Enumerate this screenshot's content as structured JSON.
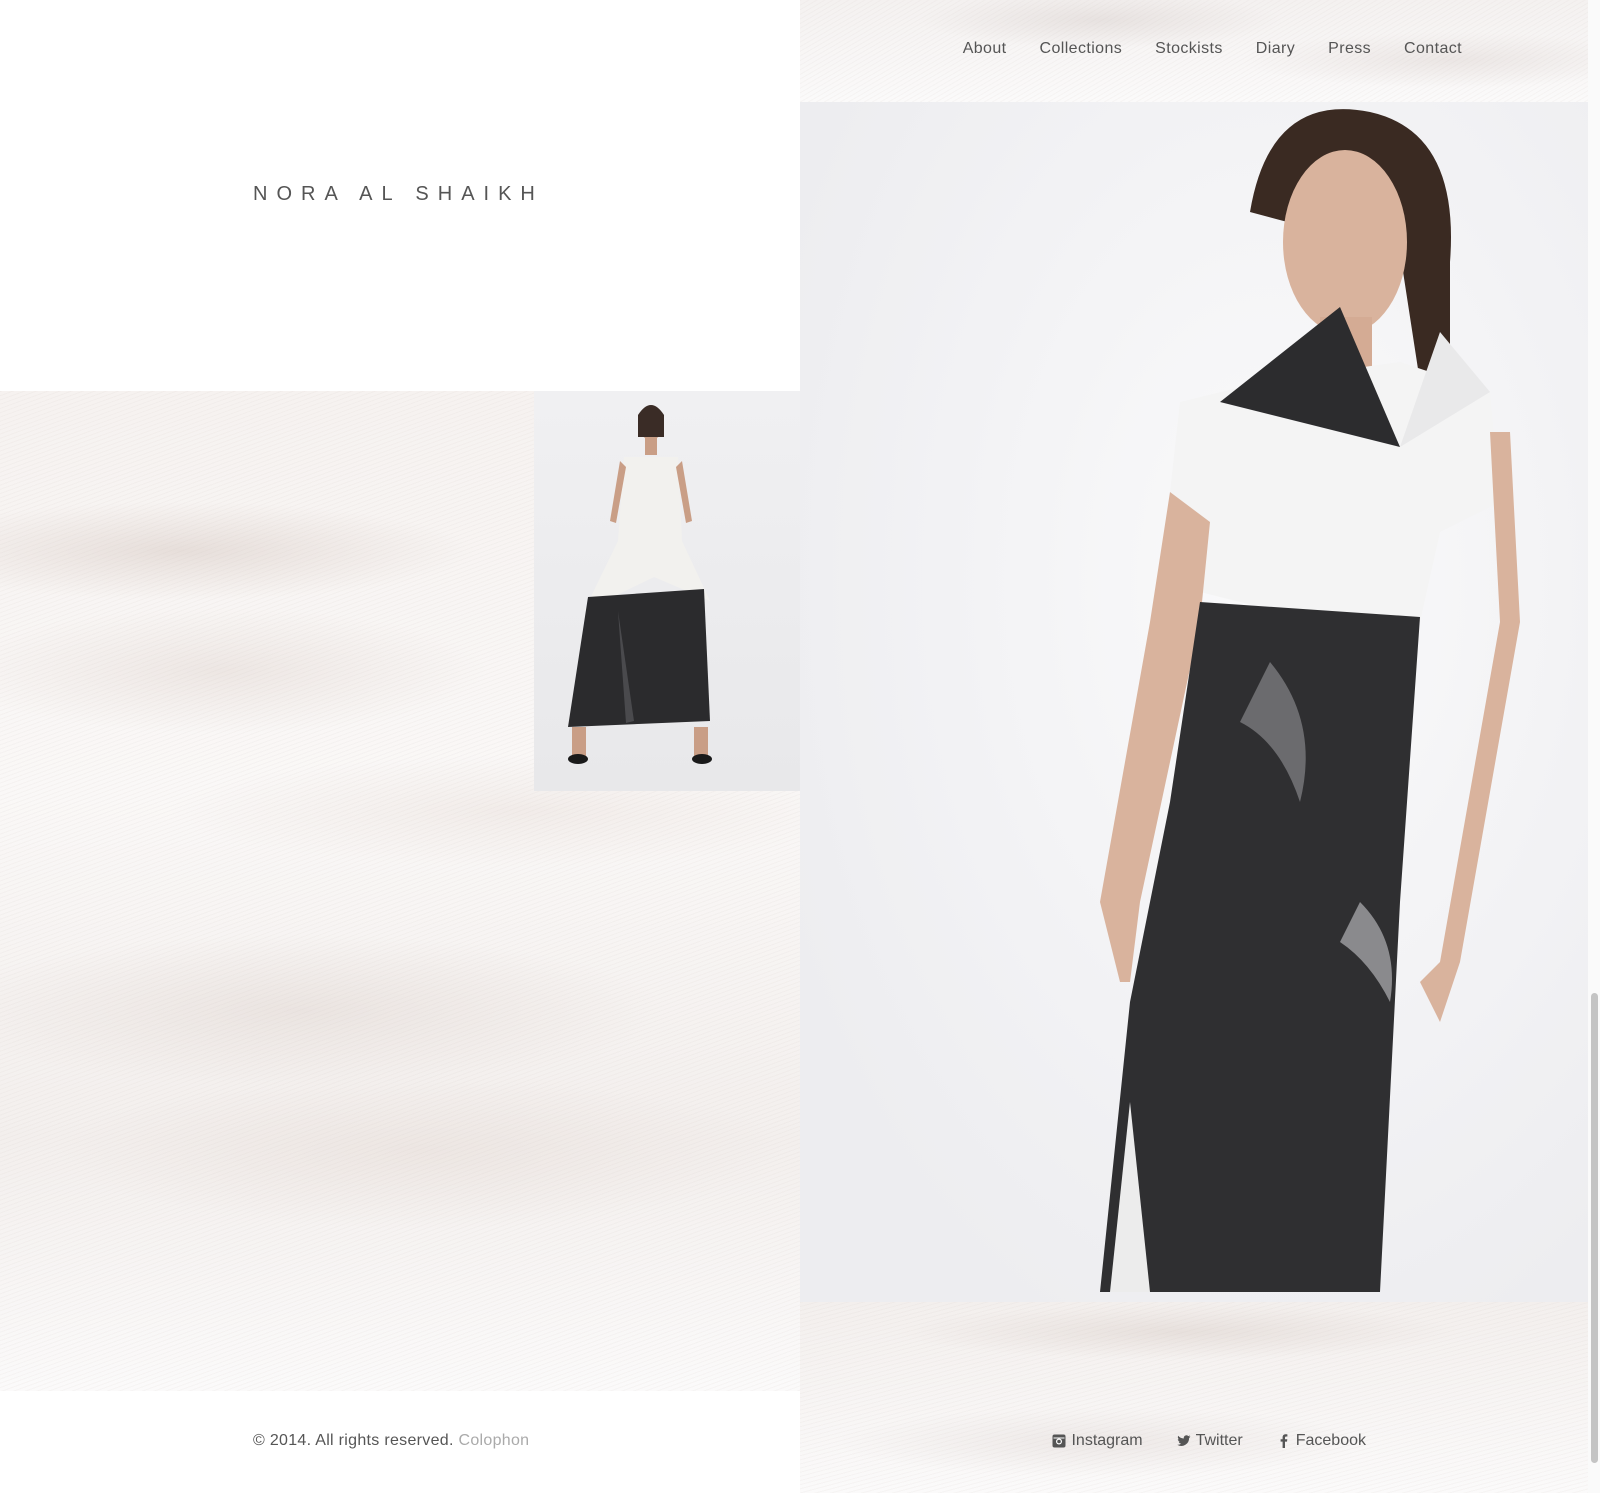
{
  "brand": {
    "name": "NORA AL SHAIKH"
  },
  "nav": {
    "items": [
      {
        "label": "About"
      },
      {
        "label": "Collections"
      },
      {
        "label": "Stockists"
      },
      {
        "label": "Diary"
      },
      {
        "label": "Press"
      },
      {
        "label": "Contact"
      }
    ]
  },
  "footer": {
    "copyright": "© 2014. All rights reserved.",
    "colophon": "Colophon",
    "social": [
      {
        "label": "Instagram",
        "icon": "instagram-icon"
      },
      {
        "label": "Twitter",
        "icon": "twitter-icon"
      },
      {
        "label": "Facebook",
        "icon": "facebook-icon"
      }
    ]
  },
  "colors": {
    "text": "#555555",
    "muted_link": "#aaaaaa",
    "garment_black": "#2a2a2c",
    "garment_white": "#f4f4f4"
  }
}
